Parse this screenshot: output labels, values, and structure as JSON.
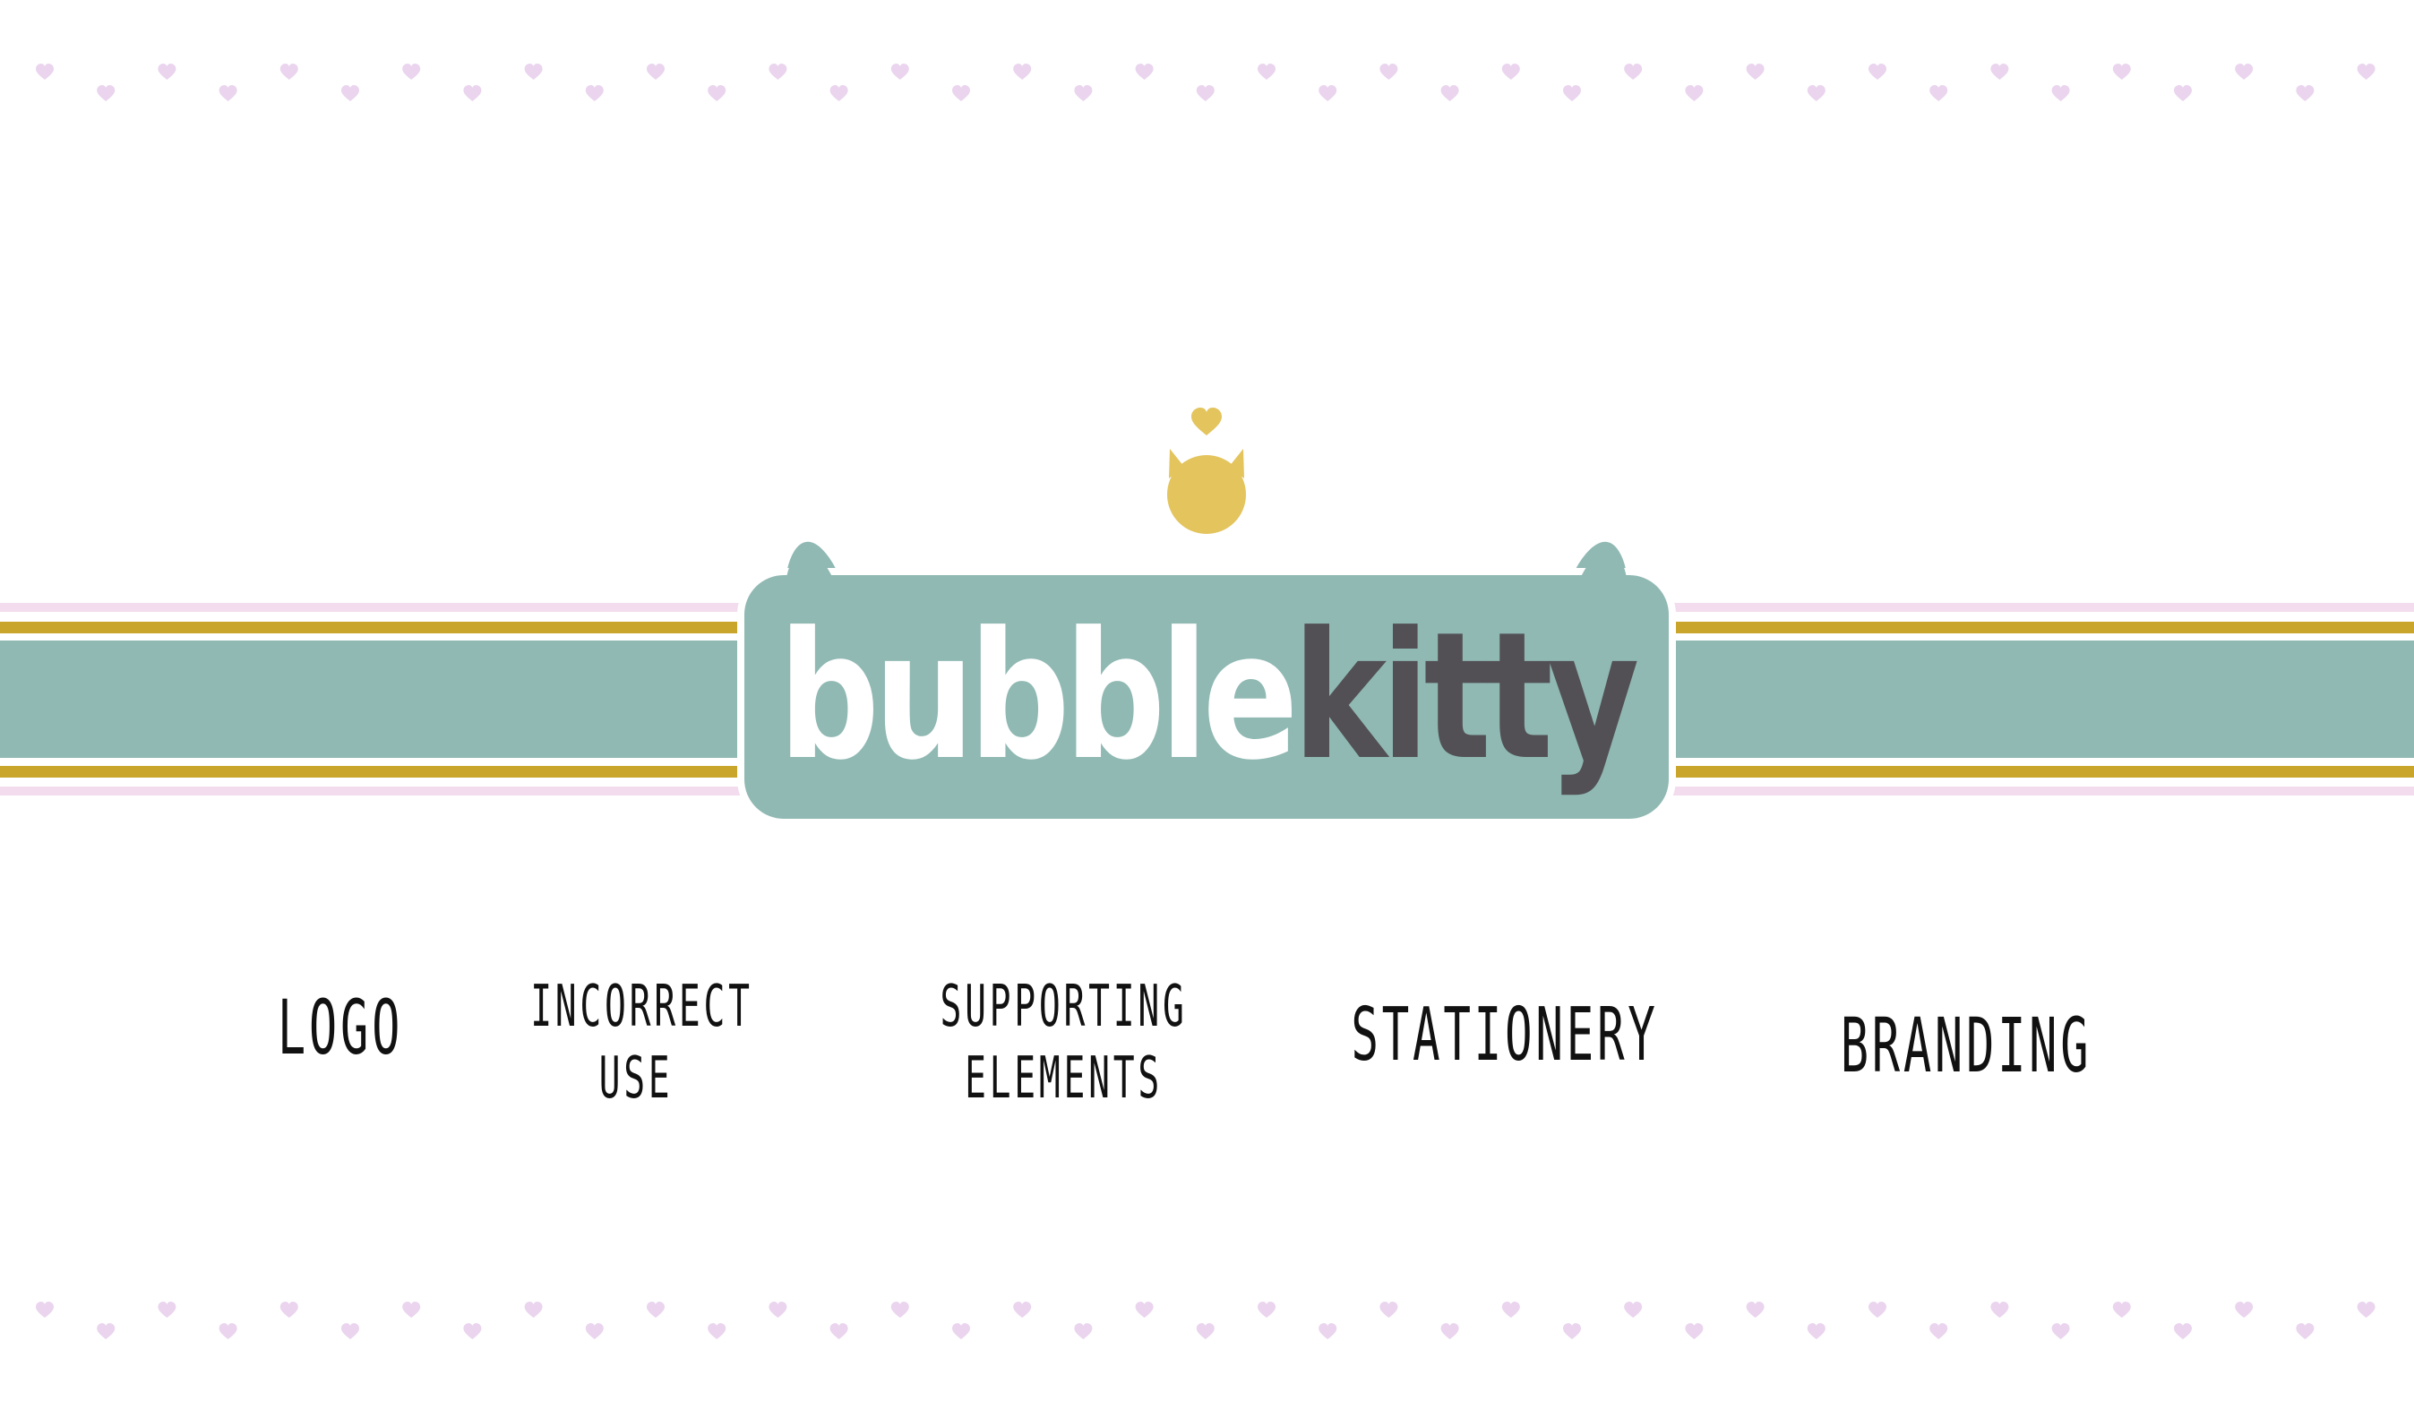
{
  "logo": {
    "word_light": "bubble",
    "word_dark": "kitty",
    "badge_icon": "cat-head-icon",
    "heart_icon": "heart-icon"
  },
  "nav": {
    "logo": "LOGO",
    "incorrect_line1": "INCORRECT",
    "incorrect_line2": "USE",
    "supporting_line1": "SUPPORTING",
    "supporting_line2": "ELEMENTS",
    "stationery": "STATIONERY",
    "branding": "BRANDING"
  },
  "colors": {
    "teal": "#90b9b3",
    "gold": "#c9a52c",
    "cat_yellow": "#e3c45d",
    "pink": "#f2dcee",
    "heart_pink": "#ead4ee",
    "dark_text": "#525055",
    "white": "#ffffff"
  }
}
